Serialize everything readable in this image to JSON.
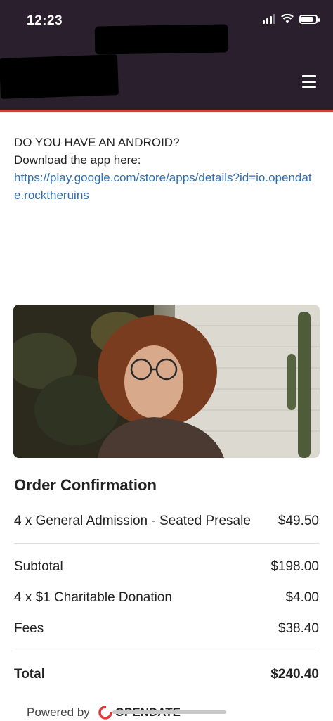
{
  "status_bar": {
    "time": "12:23"
  },
  "header": {
    "menu_icon": "hamburger-menu-icon",
    "bg_color": "#2a1f2c",
    "accent_color": "#c9483c"
  },
  "android_notice": {
    "line1": "DO YOU HAVE AN ANDROID?",
    "line2": "Download the app here:",
    "link": "https://play.google.com/store/apps/details?id=io.opendate.rocktheruins"
  },
  "order": {
    "title": "Order Confirmation",
    "line_items": [
      {
        "label": "4 x General Admission - Seated Presale",
        "amount": "$49.50"
      }
    ],
    "summary": [
      {
        "label": "Subtotal",
        "amount": "$198.00"
      },
      {
        "label": "4 x $1 Charitable Donation",
        "amount": "$4.00"
      },
      {
        "label": "Fees",
        "amount": "$38.40"
      }
    ],
    "total": {
      "label": "Total",
      "amount": "$240.40"
    }
  },
  "footer": {
    "powered_by": "Powered by",
    "brand": "OPENDATE"
  }
}
